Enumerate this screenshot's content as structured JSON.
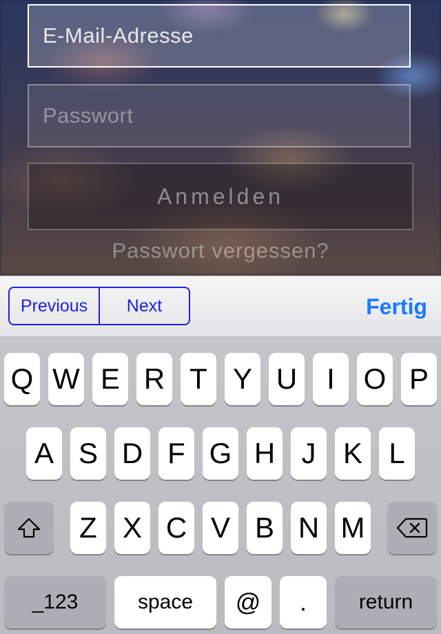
{
  "form": {
    "email_placeholder": "E-Mail-Adresse",
    "password_placeholder": "Passwort",
    "login_label": "Anmelden",
    "forgot_label": "Passwort vergessen?"
  },
  "toolbar": {
    "previous_label": "Previous",
    "next_label": "Next",
    "done_label": "Fertig"
  },
  "keyboard": {
    "row1": [
      "Q",
      "W",
      "E",
      "R",
      "T",
      "Y",
      "U",
      "I",
      "O",
      "P"
    ],
    "row2": [
      "A",
      "S",
      "D",
      "F",
      "G",
      "H",
      "J",
      "K",
      "L"
    ],
    "row3": [
      "Z",
      "X",
      "C",
      "V",
      "B",
      "N",
      "M"
    ],
    "numbers_label": "_123",
    "space_label": "space",
    "at_label": "@",
    "dot_label": ".",
    "return_label": "return",
    "shift_icon": "shift-arrow",
    "backspace_icon": "delete-left"
  },
  "colors": {
    "toolbar_segment": "#2020e0",
    "done": "#1a7aff"
  }
}
